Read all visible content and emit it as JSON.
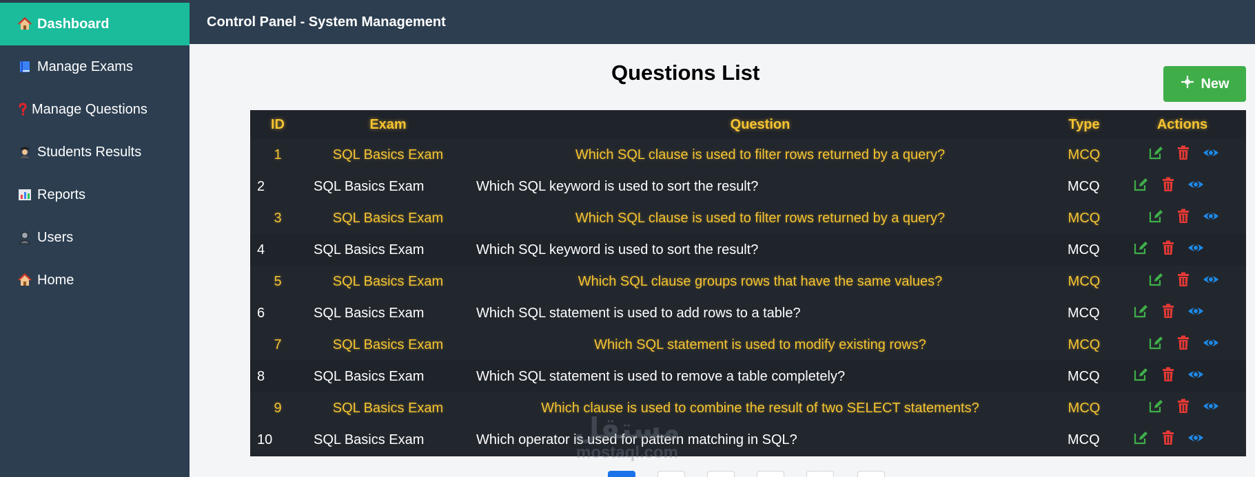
{
  "sidebar": {
    "items": [
      {
        "label": "Dashboard",
        "icon": "house-icon"
      },
      {
        "label": "Manage Exams",
        "icon": "book-icon"
      },
      {
        "label": "Manage Questions",
        "icon": "question-mark-icon"
      },
      {
        "label": "Students Results",
        "icon": "student-icon"
      },
      {
        "label": "Reports",
        "icon": "bar-chart-icon"
      },
      {
        "label": "Users",
        "icon": "user-icon"
      },
      {
        "label": "Home",
        "icon": "house-icon"
      }
    ]
  },
  "header": {
    "title": "Control Panel - System Management"
  },
  "main": {
    "title": "Questions List",
    "new_button": "New",
    "table": {
      "columns": [
        "ID",
        "Exam",
        "Question",
        "Type",
        "Actions"
      ],
      "rows": [
        {
          "id": "1",
          "exam": "SQL Basics Exam",
          "question": "Which SQL clause is used to filter rows returned by a query?",
          "type": "MCQ"
        },
        {
          "id": "2",
          "exam": "SQL Basics Exam",
          "question": "Which SQL keyword is used to sort the result?",
          "type": "MCQ"
        },
        {
          "id": "3",
          "exam": "SQL Basics Exam",
          "question": "Which SQL clause is used to filter rows returned by a query?",
          "type": "MCQ"
        },
        {
          "id": "4",
          "exam": "SQL Basics Exam",
          "question": "Which SQL keyword is used to sort the result?",
          "type": "MCQ"
        },
        {
          "id": "5",
          "exam": "SQL Basics Exam",
          "question": "Which SQL clause groups rows that have the same values?",
          "type": "MCQ"
        },
        {
          "id": "6",
          "exam": "SQL Basics Exam",
          "question": "Which SQL statement is used to add rows to a table?",
          "type": "MCQ"
        },
        {
          "id": "7",
          "exam": "SQL Basics Exam",
          "question": "Which SQL statement is used to modify existing rows?",
          "type": "MCQ"
        },
        {
          "id": "8",
          "exam": "SQL Basics Exam",
          "question": "Which SQL statement is used to remove a table completely?",
          "type": "MCQ"
        },
        {
          "id": "9",
          "exam": "SQL Basics Exam",
          "question": "Which clause is used to combine the result of two SELECT statements?",
          "type": "MCQ"
        },
        {
          "id": "10",
          "exam": "SQL Basics Exam",
          "question": "Which operator is used for pattern matching in SQL?",
          "type": "MCQ"
        }
      ]
    }
  },
  "watermark": {
    "arabic": "مستقل",
    "latin": "mostaql.com"
  },
  "colors": {
    "sidebar_bg": "#2c3e50",
    "active_item": "#1abc9c",
    "accent_yellow": "#f6c431",
    "new_button": "#3fae49",
    "edit_icon": "#3fae49",
    "delete_icon": "#e53935",
    "view_icon": "#1e88e5"
  }
}
